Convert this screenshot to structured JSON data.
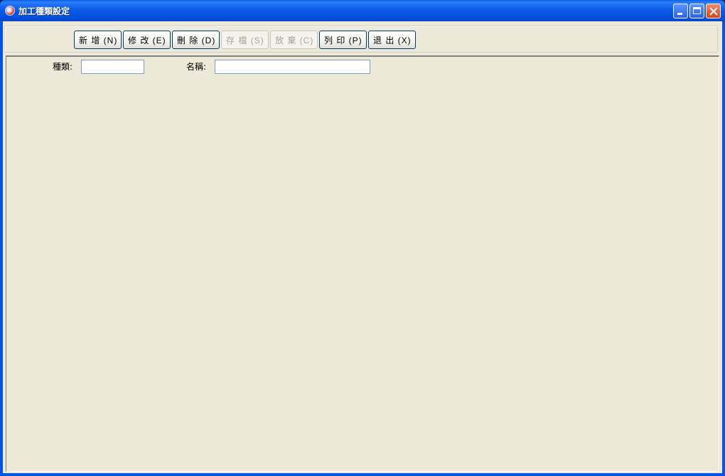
{
  "window": {
    "title": "加工種類設定"
  },
  "toolbar": {
    "buttons": [
      {
        "id": "new",
        "label": "新 增 (N)",
        "enabled": true
      },
      {
        "id": "edit",
        "label": "修 改 (E)",
        "enabled": true
      },
      {
        "id": "delete",
        "label": "刪 除 (D)",
        "enabled": true
      },
      {
        "id": "save",
        "label": "存 檔 (S)",
        "enabled": false
      },
      {
        "id": "cancel",
        "label": "放 棄 (C)",
        "enabled": false
      },
      {
        "id": "print",
        "label": "列 印 (P)",
        "enabled": true
      },
      {
        "id": "exit",
        "label": "退 出 (X)",
        "enabled": true
      }
    ]
  },
  "form": {
    "type_label": "種類:",
    "type_value": "",
    "name_label": "名稱:",
    "name_value": ""
  },
  "colors": {
    "titlebar": "#0054e3",
    "client_bg": "#ece9d8",
    "button_border": "#003c74",
    "disabled_text": "#a7a595",
    "field_border": "#7f9db9"
  }
}
